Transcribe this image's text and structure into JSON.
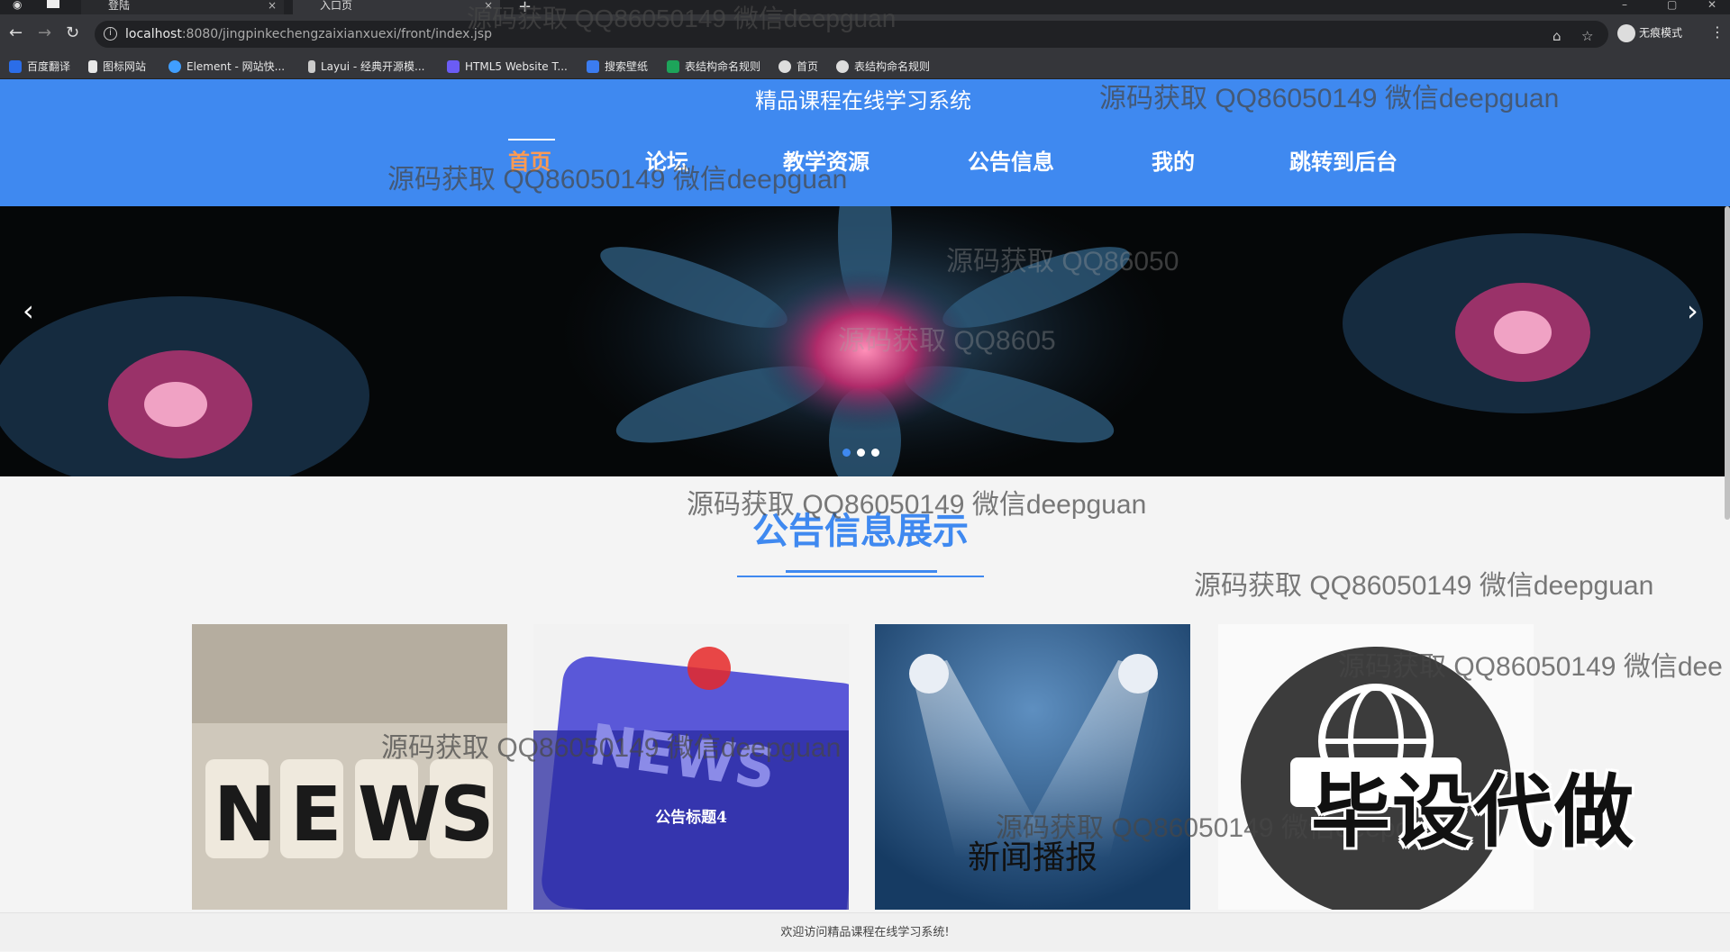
{
  "browser": {
    "tabs": [
      {
        "label": "登陆",
        "close": "×"
      },
      {
        "label": "入口页",
        "close": "×"
      }
    ],
    "new_tab": "+",
    "url_host": "localhost",
    "url_rest": ":8080/jingpinkechengzaixianxuexi/front/index.jsp",
    "profile_label": "无痕模式",
    "bookmarks": [
      {
        "label": "百度翻译",
        "icon": "baidu-translate-icon",
        "color": "#2b6de8"
      },
      {
        "label": "图标网站",
        "icon": "flag-icon",
        "color": "#e8e8e8"
      },
      {
        "label": "Element - 网站快...",
        "icon": "element-icon",
        "color": "#409eff"
      },
      {
        "label": "Layui - 经典开源模...",
        "icon": "layui-icon",
        "color": "#ccc"
      },
      {
        "label": "HTML5 Website T...",
        "icon": "html5-icon",
        "color": "#6b5cf5"
      },
      {
        "label": "搜索壁纸",
        "icon": "wallpaper-icon",
        "color": "#3b7cf0"
      },
      {
        "label": "表结构命名规则",
        "icon": "sheet-icon",
        "color": "#1da45a"
      },
      {
        "label": "首页",
        "icon": "globe-icon",
        "color": "#ddd"
      },
      {
        "label": "表结构命名规则",
        "icon": "globe-icon",
        "color": "#ddd"
      }
    ]
  },
  "site": {
    "title": "精品课程在线学习系统",
    "nav": [
      {
        "label": "首页",
        "active": true
      },
      {
        "label": "论坛",
        "active": false
      },
      {
        "label": "教学资源",
        "active": false
      },
      {
        "label": "公告信息",
        "active": false
      },
      {
        "label": "我的",
        "active": false
      },
      {
        "label": "跳转到后台",
        "active": false
      }
    ],
    "carousel": {
      "prev": "‹",
      "next": "›",
      "slides": 3,
      "active_slide": 1
    },
    "section_title": "公告信息展示",
    "cards": [
      {
        "image": "news-dice-image",
        "caption": ""
      },
      {
        "image": "news-keyboard-image",
        "caption": "公告标题4"
      },
      {
        "image": "spotlights-image",
        "caption": "新闻播报"
      },
      {
        "image": "news-globe-image",
        "caption": ""
      }
    ],
    "footer": "欢迎访问精品课程在线学习系统!"
  },
  "overlay": {
    "watermark": "源码获取 QQ86050149 微信deepguan",
    "watermark_cut": "源码获取 QQ86050149 微信dee",
    "watermark_faint_1": "源码获取 QQ86050",
    "watermark_faint_2": "源码获取 QQ8605",
    "stamp": "毕设代做"
  },
  "colors": {
    "brand_blue": "#3f89f0",
    "active_nav": "#ff9a52"
  }
}
